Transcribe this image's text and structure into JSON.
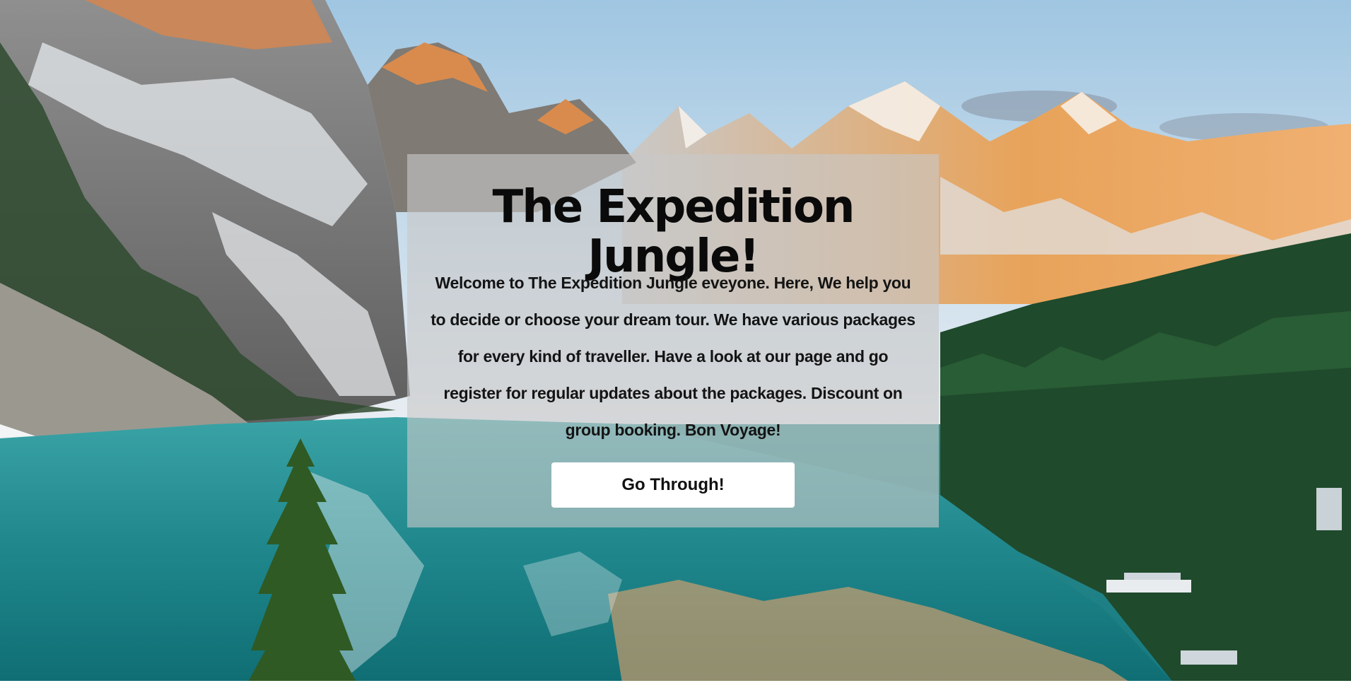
{
  "hero": {
    "title": "The Expedition Jungle!",
    "intro": "Welcome to The Expedition Jungle eveyone. Here, We help you to decide or choose your dream tour. We have various packages for every kind of traveller. Have a look at our page and go register for regular updates about the packages. Discount on group booking. Bon Voyage!",
    "cta_label": "Go Through!"
  },
  "colors": {
    "card_overlay": "#c8c8c8",
    "button_bg": "#ffffff",
    "text": "#0a0a0a",
    "lake": "#177a80",
    "sky": "#a9cde6",
    "forest": "#1f4a2c",
    "peak_glow": "#e89a4e"
  }
}
